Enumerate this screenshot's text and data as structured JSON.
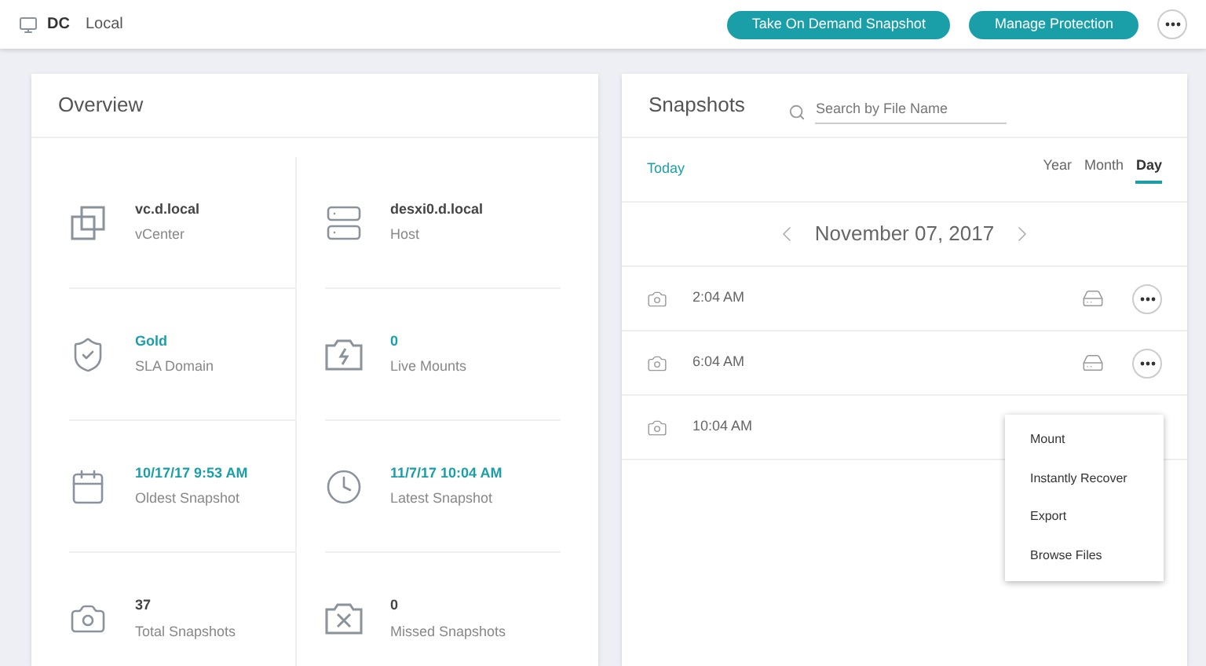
{
  "header": {
    "breadcrumb": [
      "DC",
      "Local"
    ],
    "buttons": [
      "Take On Demand Snapshot",
      "Manage Protection"
    ]
  },
  "overview": {
    "title": "Overview",
    "items": [
      {
        "value": "vc.d.local",
        "label": "vCenter",
        "accent": false
      },
      {
        "value": "desxi0.d.local",
        "label": "Host",
        "accent": false
      },
      {
        "value": "Gold",
        "label": "SLA Domain",
        "accent": true
      },
      {
        "value": "0",
        "label": "Live Mounts",
        "accent": true
      },
      {
        "value": "10/17/17 9:53 AM",
        "label": "Oldest Snapshot",
        "accent": true
      },
      {
        "value": "11/7/17 10:04 AM",
        "label": "Latest Snapshot",
        "accent": true
      },
      {
        "value": "37",
        "label": "Total Snapshots",
        "accent": false
      },
      {
        "value": "0",
        "label": "Missed Snapshots",
        "accent": false
      }
    ]
  },
  "snapshots": {
    "title": "Snapshots",
    "search": {
      "placeholder": "Search by File Name"
    },
    "today": "Today",
    "tabs": [
      {
        "label": "Year",
        "selected": false
      },
      {
        "label": "Month",
        "selected": false
      },
      {
        "label": "Day",
        "selected": true
      }
    ],
    "date": "November 07, 2017",
    "rows": [
      {
        "time": "2:04 AM"
      },
      {
        "time": "6:04 AM"
      },
      {
        "time": "10:04 AM",
        "menu": [
          "Mount",
          "Instantly Recover",
          "Export",
          "Browse Files"
        ]
      }
    ]
  }
}
